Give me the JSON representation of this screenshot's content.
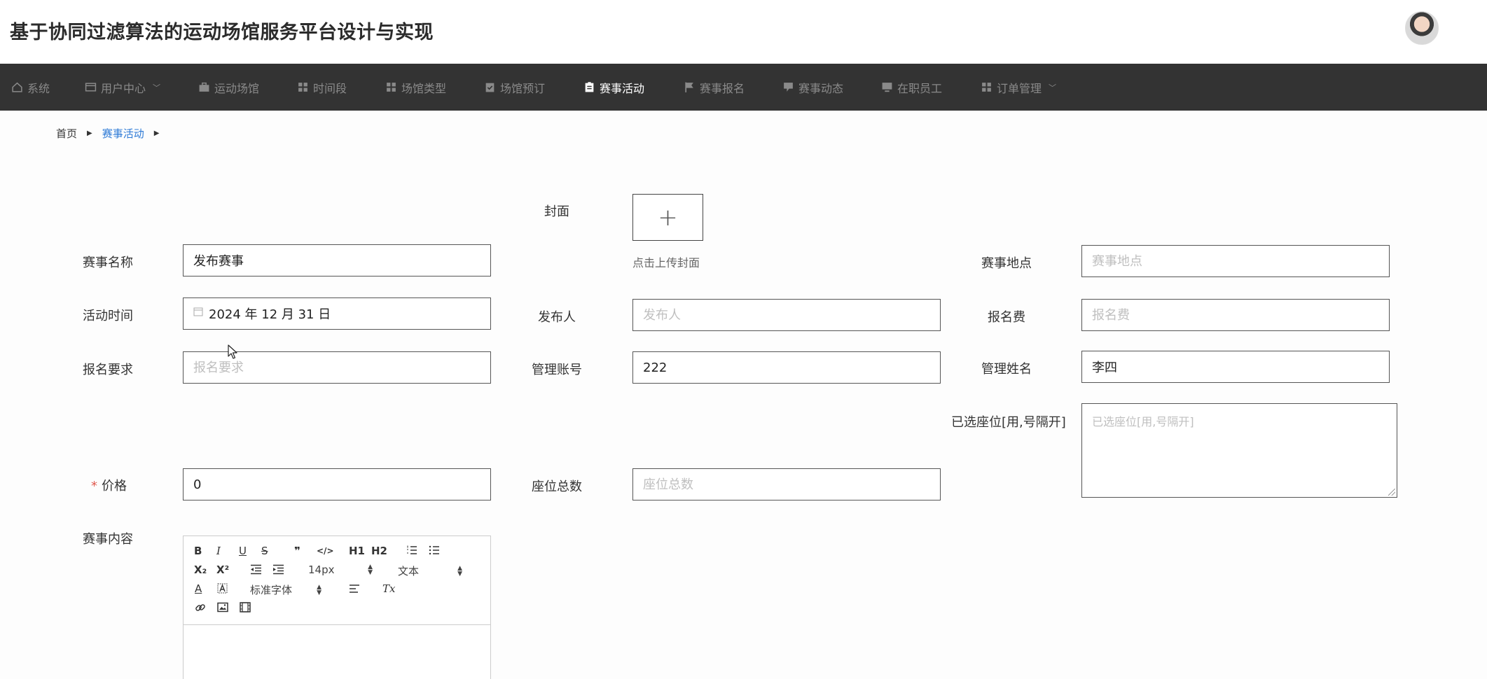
{
  "header": {
    "title": "基于协同过滤算法的运动场馆服务平台设计与实现"
  },
  "nav": {
    "items": [
      {
        "label": "系统",
        "icon": "home-icon"
      },
      {
        "label": "用户中心",
        "icon": "user-card-icon",
        "has_dropdown": true
      },
      {
        "label": "运动场馆",
        "icon": "briefcase-icon"
      },
      {
        "label": "时间段",
        "icon": "grid-icon"
      },
      {
        "label": "场馆类型",
        "icon": "grid-icon"
      },
      {
        "label": "场馆预订",
        "icon": "clipboard-check-icon"
      },
      {
        "label": "赛事活动",
        "icon": "clipboard-icon",
        "active": true
      },
      {
        "label": "赛事报名",
        "icon": "flag-icon"
      },
      {
        "label": "赛事动态",
        "icon": "comment-icon"
      },
      {
        "label": "在职员工",
        "icon": "monitor-icon"
      },
      {
        "label": "订单管理",
        "icon": "grid-icon",
        "has_dropdown": true
      }
    ]
  },
  "breadcrumb": {
    "home": "首页",
    "current": "赛事活动"
  },
  "form": {
    "cover": {
      "label": "封面",
      "upload_hint": "点击上传封面",
      "upload_symbol": "+"
    },
    "event_name": {
      "label": "赛事名称",
      "value": "发布赛事"
    },
    "event_location": {
      "label": "赛事地点",
      "placeholder": "赛事地点"
    },
    "activity_time": {
      "label": "活动时间",
      "value": "2024 年 12 月 31 日"
    },
    "publisher": {
      "label": "发布人",
      "placeholder": "发布人"
    },
    "registration_fee": {
      "label": "报名费",
      "placeholder": "报名费"
    },
    "registration_requirements": {
      "label": "报名要求",
      "placeholder": "报名要求"
    },
    "admin_account": {
      "label": "管理账号",
      "value": "222"
    },
    "admin_name": {
      "label": "管理姓名",
      "value": "李四"
    },
    "selected_seats": {
      "label": "已选座位[用,号隔开]",
      "placeholder": "已选座位[用,号隔开]"
    },
    "price": {
      "label": "价格",
      "required_mark": "*",
      "value": "0"
    },
    "total_seats": {
      "label": "座位总数",
      "placeholder": "座位总数"
    },
    "event_content": {
      "label": "赛事内容"
    }
  },
  "editor": {
    "font_size": "14px",
    "block_type": "文本",
    "font_family": "标准字体",
    "buttons": {
      "bold": "B",
      "italic": "I",
      "underline": "U",
      "strike": "S",
      "quote": "❞",
      "code": "</>",
      "h1": "H1",
      "h2": "H2",
      "sub": "X₂",
      "sup": "X²",
      "color": "A",
      "clean": "Tx"
    }
  }
}
